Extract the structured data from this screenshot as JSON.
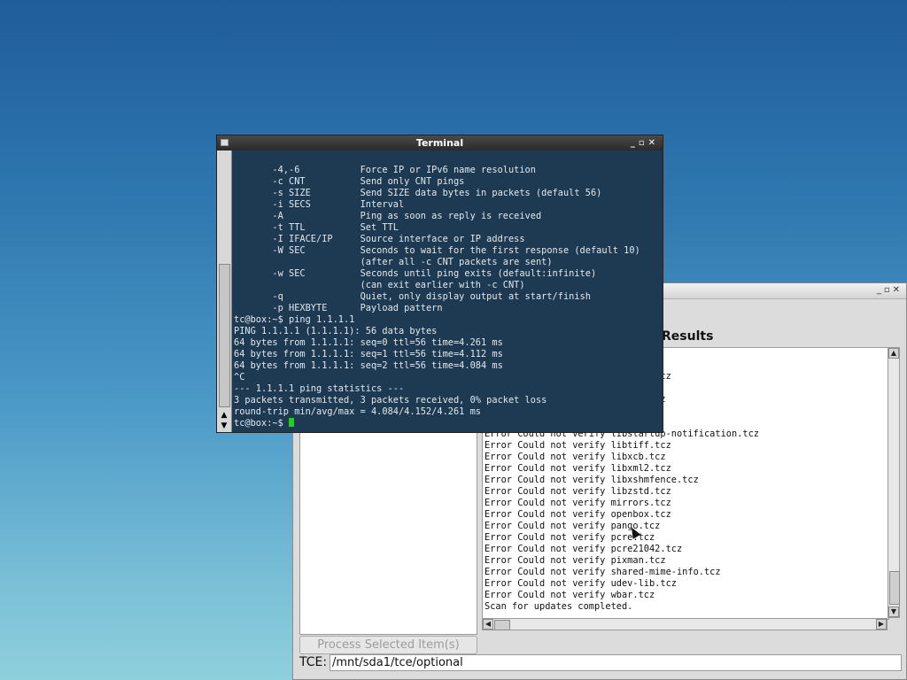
{
  "app_window": {
    "heading_text": "Results",
    "result_lines": [
      "                            .tcz",
      "                            z",
      "                            bo.tcz",
      "",
      "                            s.tcz",
      "",
      "",
      "Error Could not verify libstartup-notification.tcz",
      "Error Could not verify libtiff.tcz",
      "Error Could not verify libxcb.tcz",
      "Error Could not verify libxml2.tcz",
      "Error Could not verify libxshmfence.tcz",
      "Error Could not verify libzstd.tcz",
      "Error Could not verify mirrors.tcz",
      "Error Could not verify openbox.tcz",
      "Error Could not verify pango.tcz",
      "Error Could not verify pcre.tcz",
      "Error Could not verify pcre21042.tcz",
      "Error Could not verify pixman.tcz",
      "Error Could not verify shared-mime-info.tcz",
      "Error Could not verify udev-lib.tcz",
      "Error Could not verify wbar.tcz",
      "Scan for updates completed."
    ],
    "process_button_label": "Process Selected Item(s)",
    "tce_label": "TCE:",
    "tce_path": "/mnt/sda1/tce/optional"
  },
  "terminal": {
    "title": "Terminal",
    "lines": [
      "       -4,-6           Force IP or IPv6 name resolution",
      "       -c CNT          Send only CNT pings",
      "       -s SIZE         Send SIZE data bytes in packets (default 56)",
      "       -i SECS         Interval",
      "       -A              Ping as soon as reply is received",
      "       -t TTL          Set TTL",
      "       -I IFACE/IP     Source interface or IP address",
      "       -W SEC          Seconds to wait for the first response (default 10)",
      "                       (after all -c CNT packets are sent)",
      "       -w SEC          Seconds until ping exits (default:infinite)",
      "                       (can exit earlier with -c CNT)",
      "       -q              Quiet, only display output at start/finish",
      "       -p HEXBYTE      Payload pattern",
      "tc@box:~$ ping 1.1.1.1",
      "PING 1.1.1.1 (1.1.1.1): 56 data bytes",
      "64 bytes from 1.1.1.1: seq=0 ttl=56 time=4.261 ms",
      "64 bytes from 1.1.1.1: seq=1 ttl=56 time=4.112 ms",
      "64 bytes from 1.1.1.1: seq=2 ttl=56 time=4.084 ms",
      "^C",
      "--- 1.1.1.1 ping statistics ---",
      "3 packets transmitted, 3 packets received, 0% packet loss",
      "round-trip min/avg/max = 4.084/4.152/4.261 ms"
    ],
    "prompt": "tc@box:~$ ",
    "cursor_color": "#1fd21f"
  }
}
